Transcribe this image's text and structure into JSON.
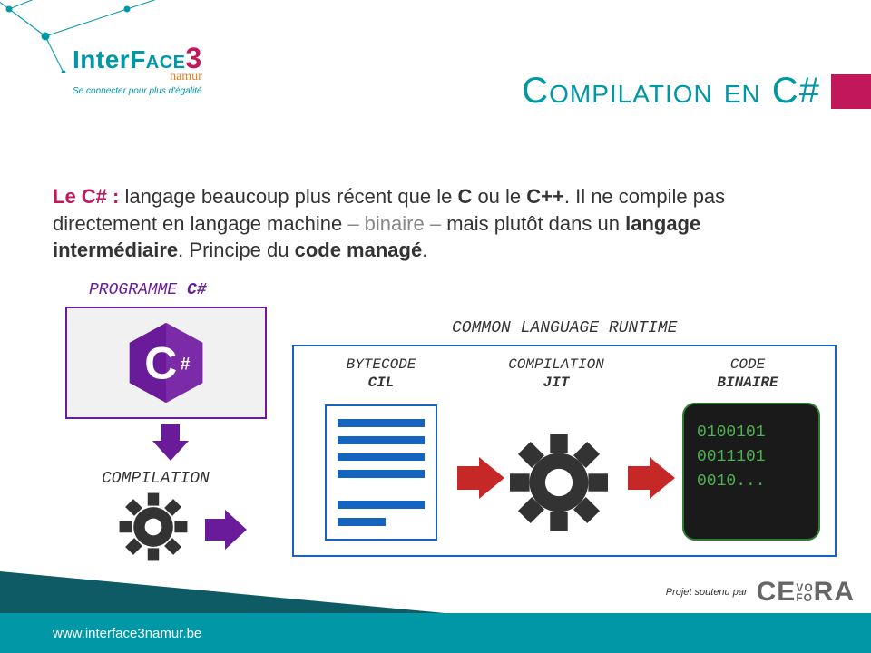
{
  "logo": {
    "part1": "Inter",
    "part2": "Face",
    "part3": "3",
    "sub": "namur",
    "tagline": "Se connecter pour plus d'égalité"
  },
  "title": "Compilation en C#",
  "paragraph": {
    "lead": "Le C# :",
    "t1": " langage beaucoup plus récent que le ",
    "b1": "C",
    "t2": " ou le ",
    "b2": "C++",
    "t3": ". Il ne compile pas directement en langage machine ",
    "g1": "– binaire –",
    "t4": " mais plutôt dans un ",
    "b3": "langage intermédiaire",
    "t5": ". Principe du ",
    "b4": "code managé",
    "t6": "."
  },
  "diagram": {
    "programme_label_1": "PROGRAMME ",
    "programme_label_2": "C#",
    "compilation_label": "COMPILATION",
    "clr_label": "COMMON LANGUAGE RUNTIME",
    "bytecode_label_1": "BYTECODE",
    "bytecode_label_2": "CIL",
    "jit_label_1": "COMPILATION",
    "jit_label_2": "JIT",
    "code_label_1": "CODE",
    "code_label_2": "BINAIRE",
    "binary_lines": "0100101\n0011101\n0010..."
  },
  "footer": {
    "url": "www.interface3namur.be",
    "project": "Projet soutenu par",
    "sponsor_1": "CE",
    "sponsor_vo": "VO",
    "sponsor_fo": "FO",
    "sponsor_2": "RA"
  }
}
